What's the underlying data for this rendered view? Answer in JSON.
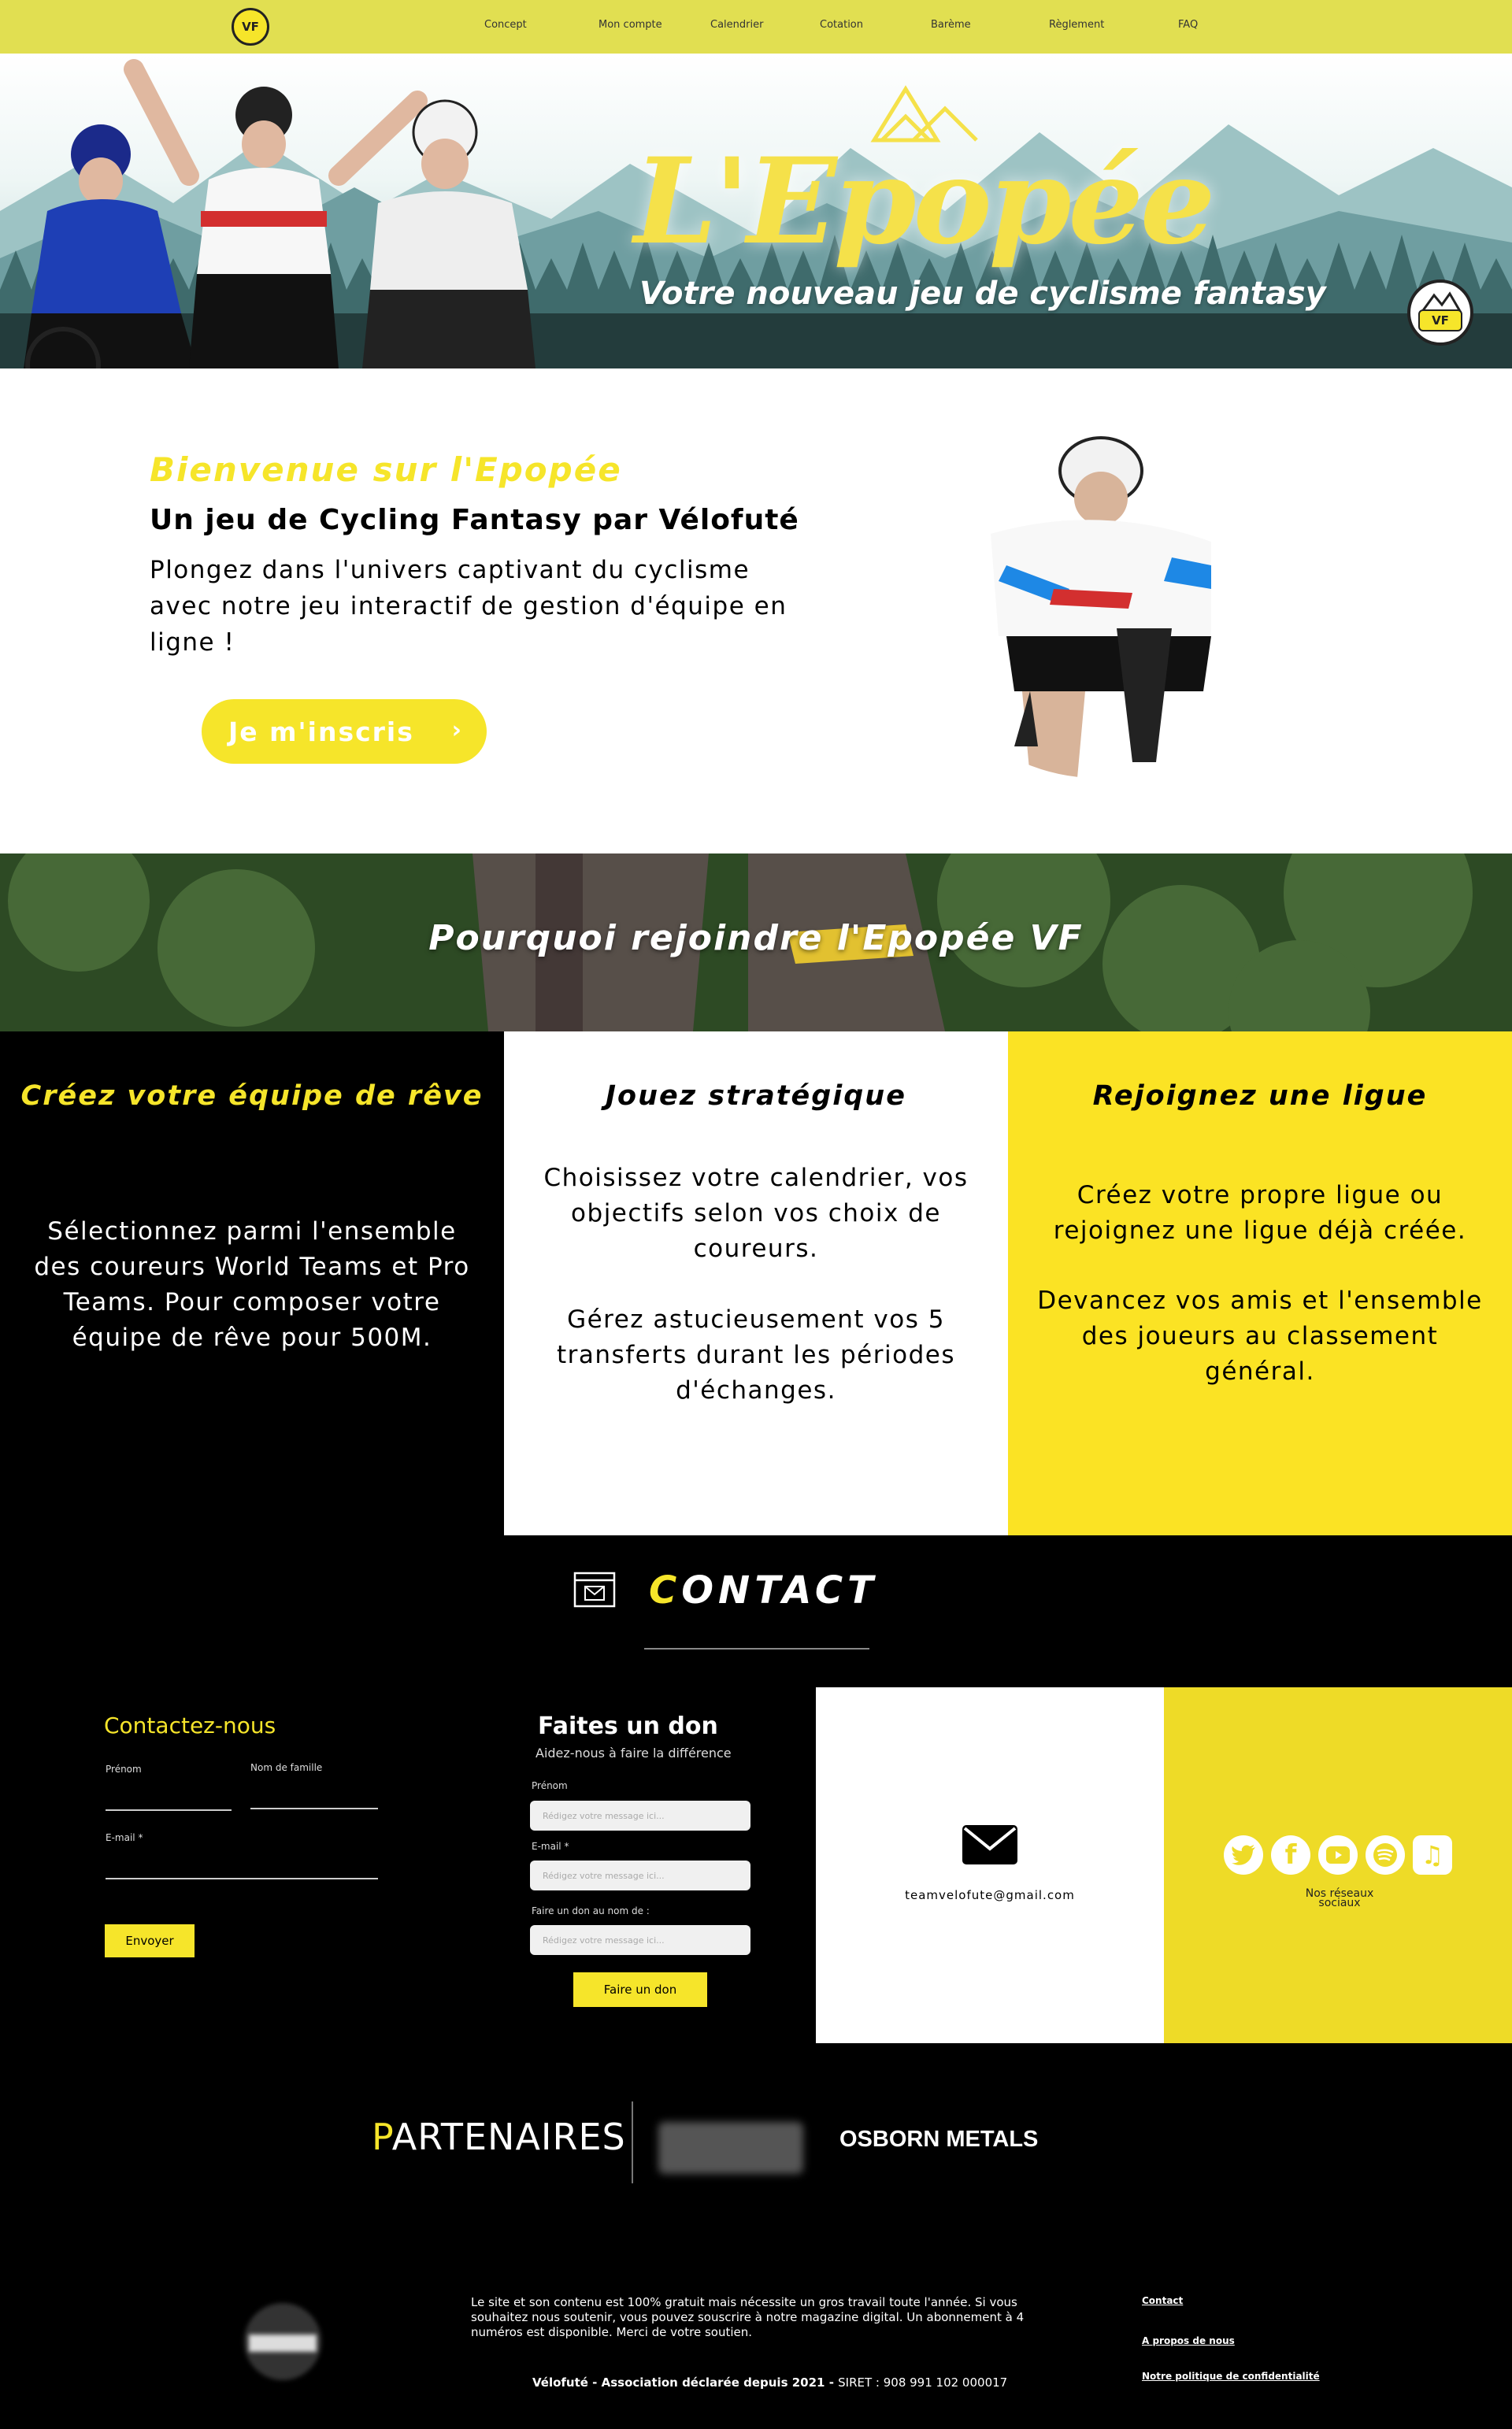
{
  "nav": {
    "logo_text": "VF",
    "items": [
      "Concept",
      "Mon compte",
      "Calendrier",
      "Cotation",
      "Barème",
      "Règlement",
      "FAQ"
    ]
  },
  "hero": {
    "title": "L'Epopée",
    "subtitle": "Votre nouveau  jeu de cyclisme fantasy",
    "badge_text": "VF"
  },
  "welcome": {
    "title": "Bienvenue sur l'Epopée",
    "subtitle": "Un jeu de Cycling Fantasy par Vélofuté",
    "text": "Plongez dans l'univers captivant du cyclisme avec notre jeu interactif de gestion d'équipe en ligne !",
    "button": "Je m'inscris"
  },
  "why": {
    "title": "Pourquoi rejoindre l'Epopée VF"
  },
  "features": [
    {
      "title": "Créez votre équipe de rêve",
      "text": "Sélectionnez parmi l'ensemble des coureurs World Teams et Pro Teams. Pour composer votre équipe de rêve pour 500M."
    },
    {
      "title": "Jouez stratégique",
      "text1": "Choisissez votre calendrier, vos objectifs selon vos choix de coureurs.",
      "text2": "Gérez astucieusement vos 5 transferts durant les périodes d'échanges."
    },
    {
      "title": "Rejoignez une ligue",
      "text1": "Créez votre propre ligue ou rejoignez une ligue déjà créée.",
      "text2": "Devancez vos amis et l'ensemble des joueurs au classement général."
    }
  ],
  "contact": {
    "title_first": "C",
    "title_rest": "ONTACT",
    "form": {
      "title": "Contactez-nous",
      "first_name_label": "Prénom",
      "last_name_label": "Nom de famille",
      "email_label": "E-mail *",
      "submit": "Envoyer"
    },
    "donation": {
      "title": "Faites un don",
      "subtitle": "Aidez-nous à faire la différence",
      "first_name_label": "Prénom",
      "email_label": "E-mail *",
      "on_behalf_label": "Faire un don au nom de :",
      "placeholder": "Rédigez votre message ici...",
      "submit": "Faire un don"
    },
    "email": "teamvelofute@gmail.com",
    "social_label": "Nos réseaux sociaux"
  },
  "partners": {
    "title_first": "P",
    "title_rest": "ARTENAIRES",
    "partner2": "OSBORN METALS"
  },
  "footer": {
    "text": "Le site et son contenu est 100% gratuit mais nécessite un gros travail toute l'année. Si vous souhaitez nous soutenir, vous pouvez souscrire à notre magazine digital. Un abonnement à 4 numéros est disponible. Merci de votre soutien.",
    "legal_bold": "Vélofuté - Association déclarée depuis 2021 - ",
    "legal_rest": "SIRET :  908 991 102 000017",
    "links": [
      "Contact",
      "A propos de nous",
      "Notre politique de confidentialité"
    ]
  },
  "colors": {
    "accent": "#f6e52a",
    "nav_bg": "#e1df51",
    "social_bg": "#eedb27",
    "dark": "#000000"
  }
}
